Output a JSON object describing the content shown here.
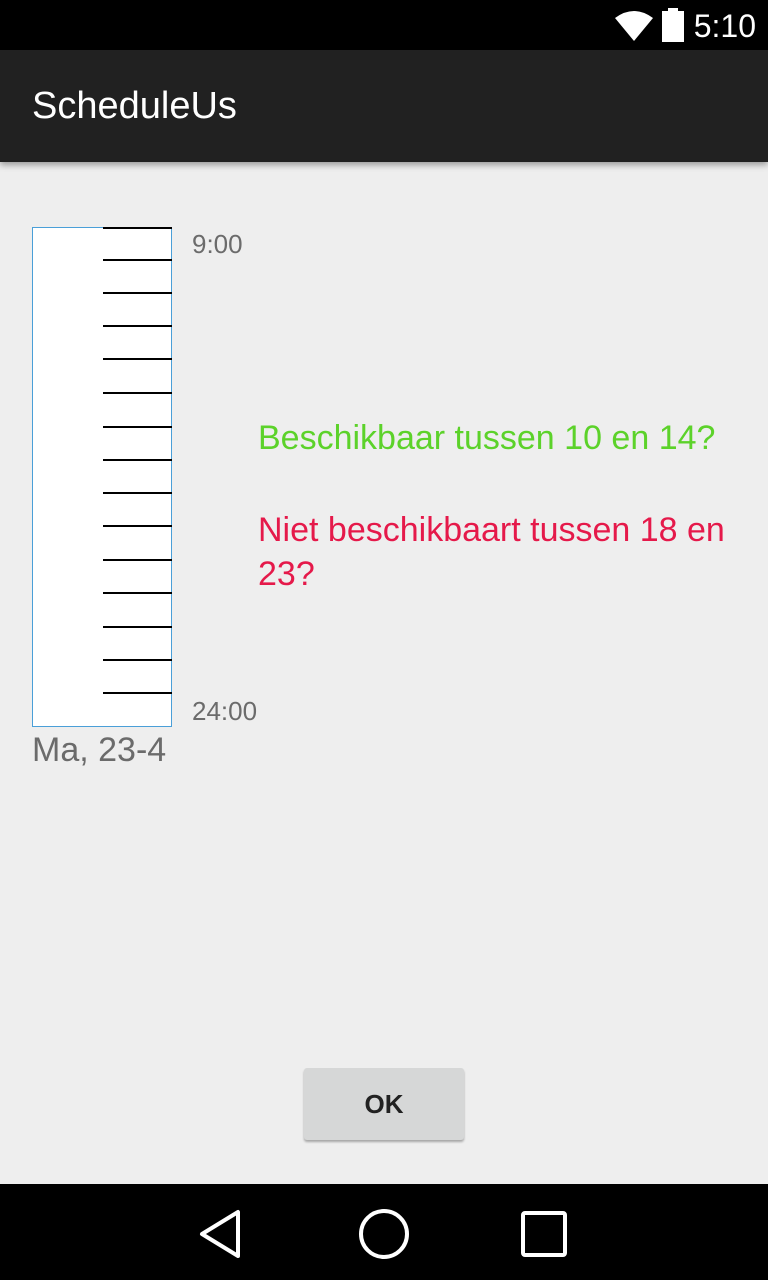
{
  "status_bar": {
    "time": "5:10",
    "icons": [
      "wifi-icon",
      "battery-icon"
    ]
  },
  "app_bar": {
    "title": "ScheduleUs"
  },
  "schedule": {
    "start_time": "9:00",
    "end_time": "24:00",
    "day_label": "Ma, 23-4"
  },
  "questions": {
    "available": "Beschikbaar tussen 10 en 14?",
    "unavailable": "Niet beschikbaart tussen 18 en 23?"
  },
  "ok_button": {
    "label": "OK"
  },
  "nav_bar": {
    "icons": [
      "back-icon",
      "home-icon",
      "recents-icon"
    ]
  },
  "colors": {
    "available_text": "#5cd22a",
    "unavailable_text": "#e5194a",
    "column_border": "#4a9fd8",
    "app_bar": "#212121"
  }
}
